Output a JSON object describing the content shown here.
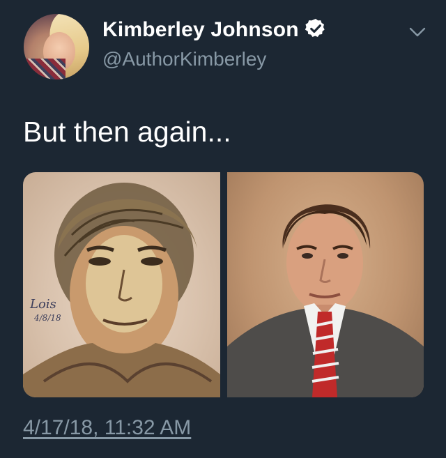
{
  "author": {
    "name": "Kimberley Johnson",
    "handle": "@AuthorKimberley",
    "verified": true,
    "avatar_icon": "profile-photo"
  },
  "tweet": {
    "text": "But then again...",
    "timestamp": "4/17/18, 11:32 AM",
    "media": [
      {
        "description_icon": "sketch-drawing-image",
        "signature": "Lois 4/8/18"
      },
      {
        "description_icon": "portrait-photo-image"
      }
    ]
  },
  "menu": {
    "icon": "chevron-down-icon"
  },
  "colors": {
    "background": "#1c2733",
    "text": "#ffffff",
    "muted": "#8899a6"
  }
}
